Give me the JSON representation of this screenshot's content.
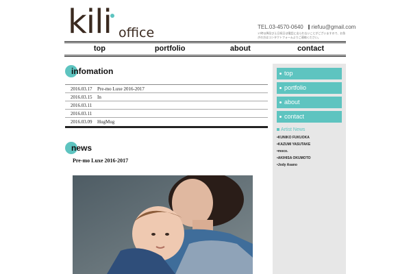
{
  "header": {
    "logo_main": "kili",
    "logo_sub": "office",
    "tel": "TEL.03-4570-0640",
    "email": "riefuu@gmail.com",
    "note": "17時以降及び土日祝日は電話に出られないことがございますので、お急ぎの方はコンタクトフォームよりご連絡ください。"
  },
  "nav": {
    "items": [
      "top",
      "portfolio",
      "about",
      "contact"
    ]
  },
  "information": {
    "heading": "infomation",
    "rows": [
      {
        "date": "2016.03.17",
        "title": "Pre-mo Luxe 2016-2017"
      },
      {
        "date": "2016.03.15",
        "title": "In"
      },
      {
        "date": "2016.03.11",
        "title": ""
      },
      {
        "date": "2016.03.11",
        "title": ""
      },
      {
        "date": "2016.03.09",
        "title": "HugMug"
      }
    ]
  },
  "news": {
    "heading": "news",
    "post_title": "Pre-mo Luxe 2016-2017"
  },
  "sidebar": {
    "buttons": [
      "top",
      "portfolio",
      "about",
      "contact"
    ],
    "artist_heading": "Artist News",
    "artists": [
      "KUNIKO FUKUOKA",
      "KAZUMI YASUTAKE",
      "moco.",
      "AKIHISA OKUMOTO",
      "Jody Asano"
    ]
  },
  "colors": {
    "accent": "#5ec4c0",
    "sidebar_bg": "#e7e7e7"
  }
}
